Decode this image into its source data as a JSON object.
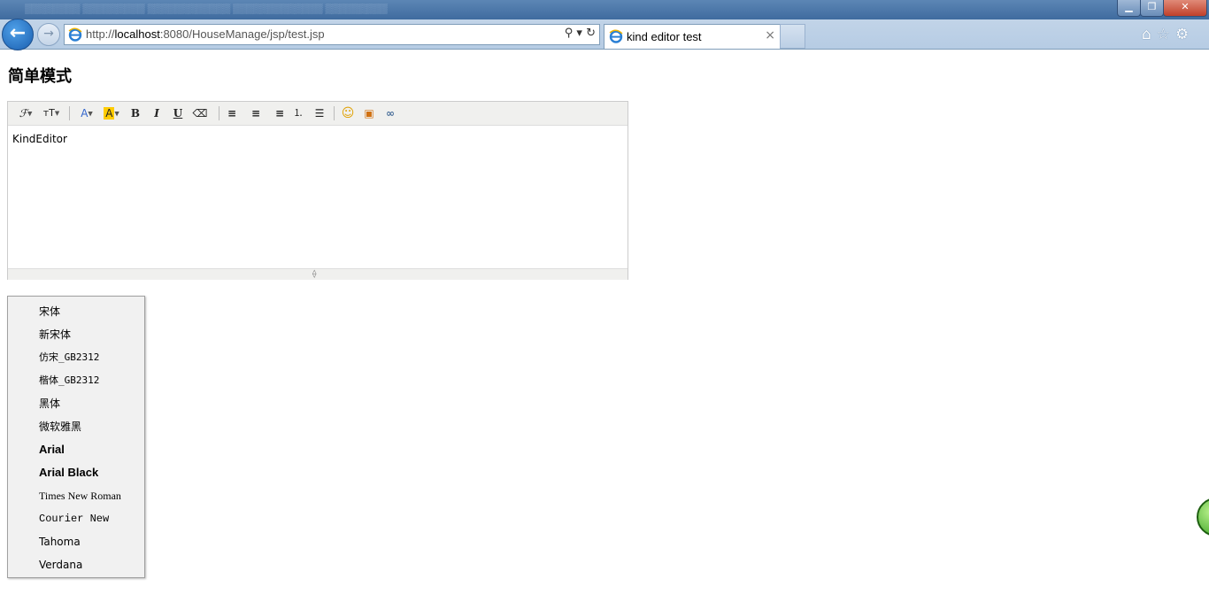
{
  "browser": {
    "address_url_prefix": "http://",
    "address_url_host": "localhost",
    "address_url_rest": ":8080/HouseManage/jsp/test.jsp",
    "tab_title": "kind editor test",
    "tab_close": "×",
    "window_min": "▁",
    "window_max": "❐",
    "window_close": "✕",
    "back_glyph": "←",
    "forward_glyph": "→",
    "addr_search": "⚲ ▾",
    "addr_refresh": "↻",
    "right_icons": "⌂☆⚙",
    "icons": [
      "ie-logo-icon",
      "search-icon",
      "refresh-icon",
      "home-icon",
      "star-icon",
      "gear-icon"
    ]
  },
  "page": {
    "title": "简单模式"
  },
  "editor": {
    "content": "KindEditor",
    "toolbar": {
      "font_name": "ℱ",
      "font_size": "ᴛT",
      "fore_color": "A",
      "hilite_color": "A",
      "bold": "B",
      "italic": "I",
      "underline": "U",
      "remove_format": "⌫",
      "justify_left": "≡",
      "justify_center": "≡",
      "justify_right": "≡",
      "ordered_list": "⒈",
      "unordered_list": "☰",
      "emoticons": "☺",
      "image": "▣",
      "link": "∞"
    },
    "resize_glyph": "⟠"
  },
  "font_menu": {
    "items": [
      "宋体",
      "新宋体",
      "仿宋_GB2312",
      "楷体_GB2312",
      "黑体",
      "微软雅黑",
      "Arial",
      "Arial Black",
      "Times New Roman",
      "Courier New",
      "Tahoma",
      "Verdana"
    ]
  },
  "colors": {
    "title_bar": "#3f6b9f",
    "close_button": "#c0402a",
    "highlight_yellow": "#ffcc00",
    "fore_color_blue": "#3366cc"
  }
}
